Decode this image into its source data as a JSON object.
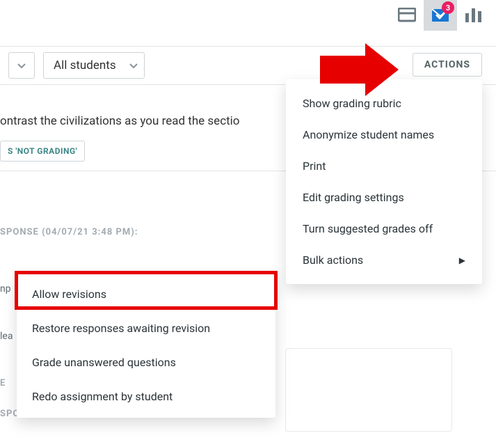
{
  "toolbar": {
    "notifications_count": "3"
  },
  "filters": {
    "students_label": "All students"
  },
  "actions_button": "ACTIONS",
  "body": {
    "prompt_fragment": "ontrast the civilizations as you read the sectio",
    "not_grading_chip": "S 'NOT GRADING'",
    "response_meta": "SPONSE (04/07/21 3:48 PM):",
    "np_fragment": "np",
    "lea_fragment": "lea",
    "e_fragment": "E",
    "spo_fragment": "SPO"
  },
  "actions_menu": {
    "items": [
      {
        "label": "Show grading rubric"
      },
      {
        "label": "Anonymize student names"
      },
      {
        "label": "Print"
      },
      {
        "label": "Edit grading settings"
      },
      {
        "label": "Turn suggested grades off"
      },
      {
        "label": "Bulk actions",
        "submenu": true
      }
    ]
  },
  "bulk_menu": {
    "items": [
      {
        "label": "Allow revisions"
      },
      {
        "label": "Restore responses awaiting revision"
      },
      {
        "label": "Grade unanswered questions"
      },
      {
        "label": "Redo assignment by student"
      }
    ]
  }
}
